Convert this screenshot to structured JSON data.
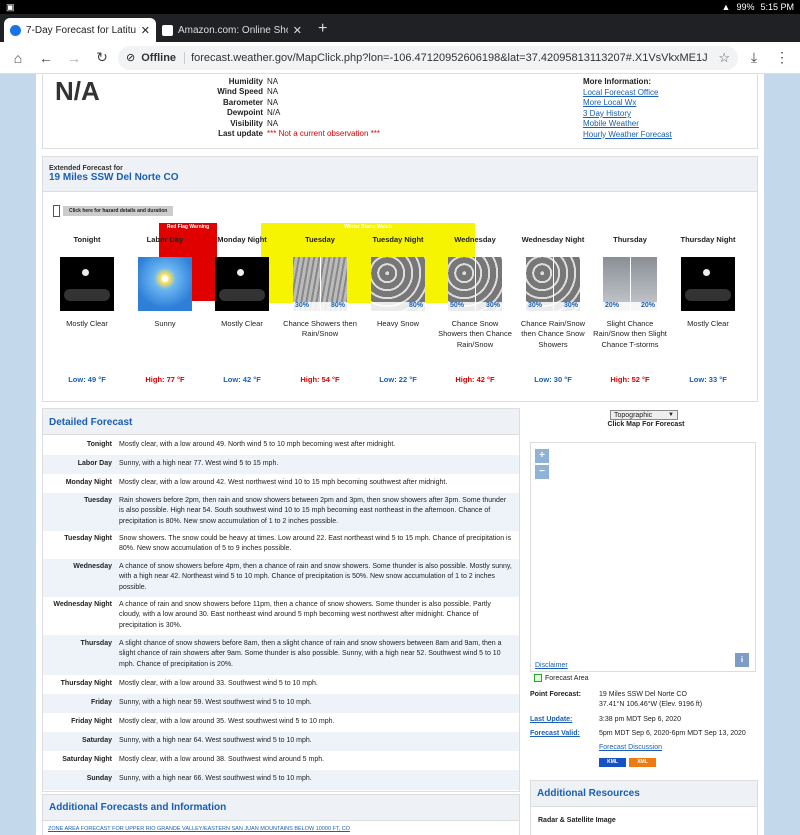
{
  "status_bar": {
    "time": "5:15 PM",
    "battery": "99%"
  },
  "tabs": [
    {
      "title": "7-Day Forecast for Latitude 3",
      "favicon_color": "#1a73e8"
    },
    {
      "title": "Amazon.com: Online Shoppi",
      "favicon_color": "#ffffff"
    }
  ],
  "address_bar": {
    "offline_label": "Offline",
    "url": "forecast.weather.gov/MapClick.php?lon=-106.47120952606198&lat=37.42095813113207#.X1VsVkxME1J"
  },
  "current": {
    "temp": "N/A",
    "rows": [
      {
        "label": "Humidity",
        "value": "NA"
      },
      {
        "label": "Wind Speed",
        "value": "NA"
      },
      {
        "label": "Barometer",
        "value": "NA"
      },
      {
        "label": "Dewpoint",
        "value": "N/A"
      },
      {
        "label": "Visibility",
        "value": "NA"
      },
      {
        "label": "Last update",
        "value": "*** Not a current observation ***"
      }
    ],
    "more_title": "More Information:",
    "more_links": [
      "Local Forecast Office",
      "More Local Wx",
      "3 Day History",
      "Mobile Weather",
      "Hourly Weather Forecast"
    ]
  },
  "extended": {
    "label": "Extended Forecast for",
    "location": "19 Miles SSW Del Norte CO",
    "hazard_button": "Click here for hazard details and duration",
    "red_flag": "Red Flag Warning",
    "winter_watch": "Winter Storm Watch",
    "periods": [
      {
        "name": "Tonight",
        "desc": "Mostly Clear",
        "temp": "Low: 49 °F",
        "kind": "low",
        "pct_left": "",
        "pct_right": ""
      },
      {
        "name": "Labor Day",
        "desc": "Sunny",
        "temp": "High: 77 °F",
        "kind": "high",
        "pct_left": "",
        "pct_right": ""
      },
      {
        "name": "Monday Night",
        "desc": "Mostly Clear",
        "temp": "Low: 42 °F",
        "kind": "low",
        "pct_left": "",
        "pct_right": ""
      },
      {
        "name": "Tuesday",
        "desc": "Chance Showers then Rain/Snow",
        "temp": "High: 54 °F",
        "kind": "high",
        "pct_left": "30%",
        "pct_right": "80%"
      },
      {
        "name": "Tuesday Night",
        "desc": "Heavy Snow",
        "temp": "Low: 22 °F",
        "kind": "low",
        "pct_left": "",
        "pct_right": "80%"
      },
      {
        "name": "Wednesday",
        "desc": "Chance Snow Showers then Chance Rain/Snow",
        "temp": "High: 42 °F",
        "kind": "high",
        "pct_left": "50%",
        "pct_right": "30%"
      },
      {
        "name": "Wednesday Night",
        "desc": "Chance Rain/Snow then Chance Snow Showers",
        "temp": "Low: 30 °F",
        "kind": "low",
        "pct_left": "30%",
        "pct_right": "30%"
      },
      {
        "name": "Thursday",
        "desc": "Slight Chance Rain/Snow then Slight Chance T-storms",
        "temp": "High: 52 °F",
        "kind": "high",
        "pct_left": "20%",
        "pct_right": "20%"
      },
      {
        "name": "Thursday Night",
        "desc": "Mostly Clear",
        "temp": "Low: 33 °F",
        "kind": "low",
        "pct_left": "",
        "pct_right": ""
      }
    ]
  },
  "detailed": {
    "title": "Detailed Forecast",
    "rows": [
      {
        "day": "Tonight",
        "text": "Mostly clear, with a low around 49. North wind 5 to 10 mph becoming west after midnight."
      },
      {
        "day": "Labor Day",
        "text": "Sunny, with a high near 77. West wind 5 to 15 mph."
      },
      {
        "day": "Monday Night",
        "text": "Mostly clear, with a low around 42. West northwest wind 10 to 15 mph becoming southwest after midnight."
      },
      {
        "day": "Tuesday",
        "text": "Rain showers before 2pm, then rain and snow showers between 2pm and 3pm, then snow showers after 3pm. Some thunder is also possible. High near 54. South southwest wind 10 to 15 mph becoming east northeast in the afternoon. Chance of precipitation is 80%. New snow accumulation of 1 to 2 inches possible."
      },
      {
        "day": "Tuesday Night",
        "text": "Snow showers. The snow could be heavy at times. Low around 22. East northeast wind 5 to 15 mph. Chance of precipitation is 80%. New snow accumulation of 5 to 9 inches possible."
      },
      {
        "day": "Wednesday",
        "text": "A chance of snow showers before 4pm, then a chance of rain and snow showers. Some thunder is also possible. Mostly sunny, with a high near 42. Northeast wind 5 to 10 mph. Chance of precipitation is 50%. New snow accumulation of 1 to 2 inches possible."
      },
      {
        "day": "Wednesday Night",
        "text": "A chance of rain and snow showers before 11pm, then a chance of snow showers. Some thunder is also possible. Partly cloudy, with a low around 30. East northeast wind around 5 mph becoming west northwest after midnight. Chance of precipitation is 30%."
      },
      {
        "day": "Thursday",
        "text": "A slight chance of snow showers before 8am, then a slight chance of rain and snow showers between 8am and 9am, then a slight chance of rain showers after 9am. Some thunder is also possible. Sunny, with a high near 52. Southwest wind 5 to 10 mph. Chance of precipitation is 20%."
      },
      {
        "day": "Thursday Night",
        "text": "Mostly clear, with a low around 33. Southwest wind 5 to 10 mph."
      },
      {
        "day": "Friday",
        "text": "Sunny, with a high near 59. West southwest wind 5 to 10 mph."
      },
      {
        "day": "Friday Night",
        "text": "Mostly clear, with a low around 35. West southwest wind 5 to 10 mph."
      },
      {
        "day": "Saturday",
        "text": "Sunny, with a high near 64. West southwest wind 5 to 10 mph."
      },
      {
        "day": "Saturday Night",
        "text": "Mostly clear, with a low around 38. Southwest wind around 5 mph."
      },
      {
        "day": "Sunday",
        "text": "Sunny, with a high near 66. West southwest wind 5 to 10 mph."
      }
    ]
  },
  "map": {
    "select_value": "Topographic",
    "label": "Click Map For Forecast",
    "zoom_in": "+",
    "zoom_out": "−",
    "disclaimer": "Disclaimer",
    "info": "i",
    "forecast_area": "Forecast Area"
  },
  "point": {
    "pf_label": "Point Forecast:",
    "pf_line1": "19 Miles SSW Del Norte CO",
    "pf_line2": "37.41°N 106.46°W (Elev. 9196 ft)",
    "lu_label": "Last Update:",
    "lu_value": "3:38 pm MDT Sep 6, 2020",
    "fv_label": "Forecast Valid:",
    "fv_value": "5pm MDT Sep 6, 2020-6pm MDT Sep 13, 2020",
    "discussion": "Forecast Discussion",
    "kml": "KML",
    "xml": "XML"
  },
  "additional": {
    "title": "Additional Forecasts and Information",
    "zone_link": "ZONE AREA FORECAST FOR UPPER RIO GRANDE VALLEY/EASTERN SAN JUAN MOUNTAINS BELOW 10000 FT, CO"
  },
  "resources": {
    "title": "Additional Resources",
    "radar": "Radar & Satellite Image"
  }
}
